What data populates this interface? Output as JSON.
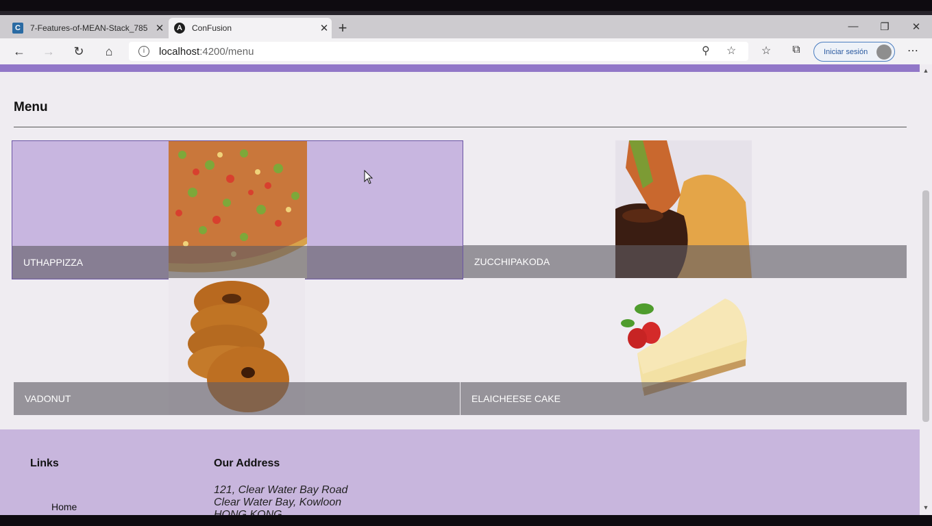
{
  "browser": {
    "tabs": [
      {
        "title": "7-Features-of-MEAN-Stack_785",
        "favicon": "C",
        "active": false
      },
      {
        "title": "ConFusion",
        "favicon": "A",
        "active": true
      }
    ],
    "url": {
      "host": "localhost",
      "path": ":4200/menu"
    },
    "signin_label": "Iniciar sesión"
  },
  "page": {
    "menu_title": "Menu",
    "dishes": [
      {
        "name": "UTHAPPIZZA"
      },
      {
        "name": "ZUCCHIPAKODA"
      },
      {
        "name": "VADONUT"
      },
      {
        "name": "ELAICHEESE CAKE"
      }
    ],
    "footer": {
      "links_heading": "Links",
      "links": [
        "Home"
      ],
      "address_heading": "Our Address",
      "address_lines": [
        "121, Clear Water Bay Road",
        "Clear Water Bay, Kowloon",
        "HONG KONG"
      ]
    }
  },
  "colors": {
    "accent": "#9177c8",
    "footer": "#c8b6dd",
    "hover_tile": "#c8b6e0"
  }
}
